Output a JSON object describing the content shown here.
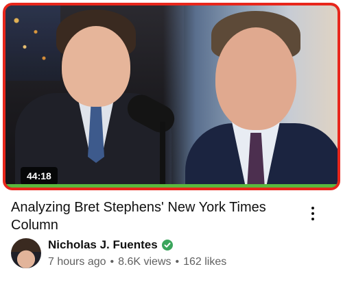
{
  "video": {
    "duration": "44:18",
    "progress_fraction": 1.0,
    "progress_color": "#5bb83d",
    "border_color": "#e8261b",
    "title": "Analyzing Bret Stephens' New York Times Column"
  },
  "channel": {
    "name": "Nicholas J. Fuentes",
    "verified_icon": "check-circle-icon",
    "verified_color": "#3ba55c"
  },
  "meta": {
    "uploaded": "7 hours ago",
    "views": "8.6K views",
    "likes": "162 likes",
    "separator": "•"
  },
  "menu": {
    "icon": "more-vert-icon"
  }
}
